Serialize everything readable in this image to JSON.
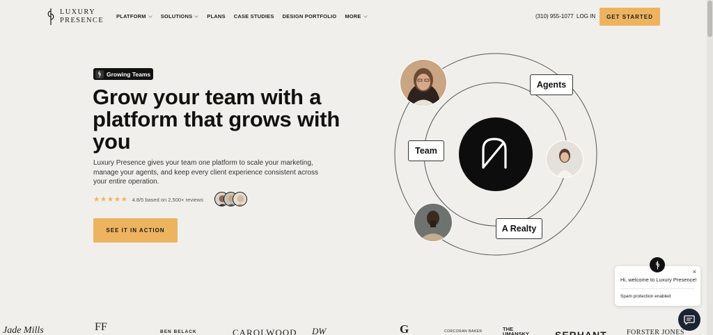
{
  "header": {
    "logo_text_line1": "LUXURY",
    "logo_text_line2": "PRESENCE",
    "nav": [
      {
        "label": "PLATFORM",
        "has_dropdown": true
      },
      {
        "label": "SOLUTIONS",
        "has_dropdown": true
      },
      {
        "label": "PLANS",
        "has_dropdown": false
      },
      {
        "label": "CASE STUDIES",
        "has_dropdown": false
      },
      {
        "label": "DESIGN PORTFOLIO",
        "has_dropdown": false
      },
      {
        "label": "MORE",
        "has_dropdown": true
      }
    ],
    "phone": "(310) 955-1077",
    "login": "LOG IN",
    "get_started": "GET STARTED"
  },
  "hero": {
    "badge": "Growing Teams",
    "title": "Grow your team with a platform that grows with you",
    "subtitle": "Luxury Presence gives your team one platform to scale your marketing, manage your agents, and keep every client experience consistent across your entire operation.",
    "stars": "★★★★★",
    "rating_text": "4.8/5 based on 2,500+ reviews",
    "cta": "SEE IT IN ACTION"
  },
  "orbit": {
    "labels": {
      "team": "Team",
      "agents": "Agents",
      "realty": "A Realty"
    }
  },
  "chat": {
    "welcome": "Hi, welcome to Luxury Presence!",
    "spam": "Spam protection enabled",
    "close": "×"
  },
  "logos": [
    {
      "text": "Jade Mills"
    },
    {
      "text": "FF"
    },
    {
      "text": "BEN BELACK"
    },
    {
      "text": "CAROLWOOD"
    },
    {
      "text": "DW"
    },
    {
      "text": "G"
    },
    {
      "text": "CORCORAN BAKER"
    },
    {
      "text": "THE UMANSKY"
    },
    {
      "text": "SERHANT"
    },
    {
      "text": "FORSTER JONES"
    }
  ],
  "colors": {
    "background": "#f1efeb",
    "accent": "#eeb35f",
    "dark": "#111111",
    "chat_launcher": "#1a2433"
  }
}
